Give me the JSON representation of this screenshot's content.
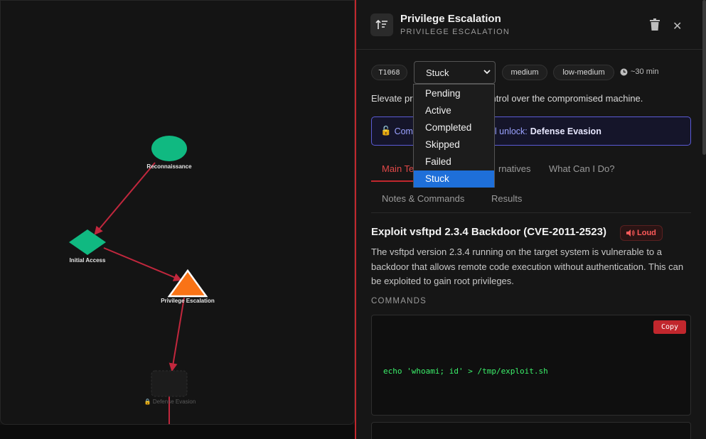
{
  "graph": {
    "nodes": [
      {
        "label": "Reconnaissance",
        "status": "completed",
        "color": "#10b981"
      },
      {
        "label": "Initial Access",
        "status": "completed",
        "color": "#10b981"
      },
      {
        "label": "Privilege Escalation",
        "status": "active",
        "color": "#f97316"
      },
      {
        "label": "Defense Evasion",
        "status": "locked",
        "color": "#222222"
      }
    ],
    "edge_color": "#c1273d"
  },
  "panel": {
    "icon": "sort-arrows-icon",
    "title": "Privilege Escalation",
    "subtitle": "PRIVILEGE ESCALATION",
    "technique_id": "T1068",
    "status": "Stuck",
    "risk": "medium",
    "difficulty": "low-medium",
    "time": "~30 min",
    "description_visible_left": "Elevate pr",
    "description_visible_right": "control over the compromised machine.",
    "unlock_visible_left": "Comp",
    "unlock_visible_mid": "l unlock:",
    "unlock_target": "Defense Evasion",
    "tabs": {
      "main_partial": "Main Te",
      "alternatives_partial": "rnatives",
      "what_can_i_do": "What Can I Do?",
      "notes": "Notes & Commands",
      "results": "Results"
    },
    "section": {
      "title": "Exploit vsftpd 2.3.4 Backdoor (CVE-2011-2523)",
      "badge": "Loud",
      "paragraph": "The vsftpd version 2.3.4 running on the target system is vulnerable to a backdoor that allows remote code execution without authentication. This can be exploited to gain root privileges.",
      "commands_heading": "COMMANDS",
      "copy_label": "Copy",
      "command": "echo 'whoami; id' > /tmp/exploit.sh"
    }
  },
  "status_dropdown": {
    "options": [
      "Pending",
      "Active",
      "Completed",
      "Skipped",
      "Failed",
      "Stuck"
    ],
    "selected": "Stuck"
  },
  "colors": {
    "accent": "#c1272d",
    "unlock_border": "#5b5bd6",
    "code_text": "#3bf06a",
    "selected_option": "#1e6fd9"
  }
}
